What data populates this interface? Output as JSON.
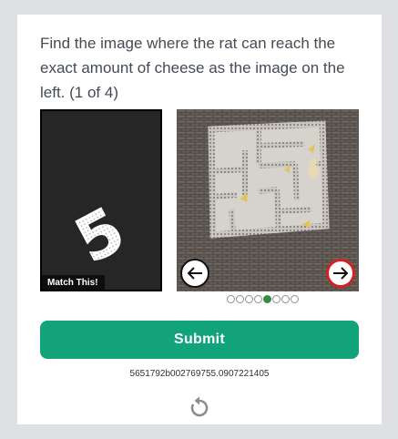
{
  "challenge": {
    "instruction": "Find the image where the rat can reach the exact amount of cheese as the image on the left. (1 of 4)",
    "reference_label": "Match This!",
    "reference_digit": "5",
    "carousel": {
      "total_slides": 8,
      "active_index": 4,
      "prev_icon": "arrow-left-icon",
      "next_icon": "arrow-right-icon"
    }
  },
  "actions": {
    "submit_label": "Submit",
    "reload_icon": "reload-icon"
  },
  "session_id": "5651792b002769755.0907221405",
  "colors": {
    "submit_bg": "#12a37a",
    "active_dot": "#3a8a46",
    "next_border": "#d61f1f"
  }
}
